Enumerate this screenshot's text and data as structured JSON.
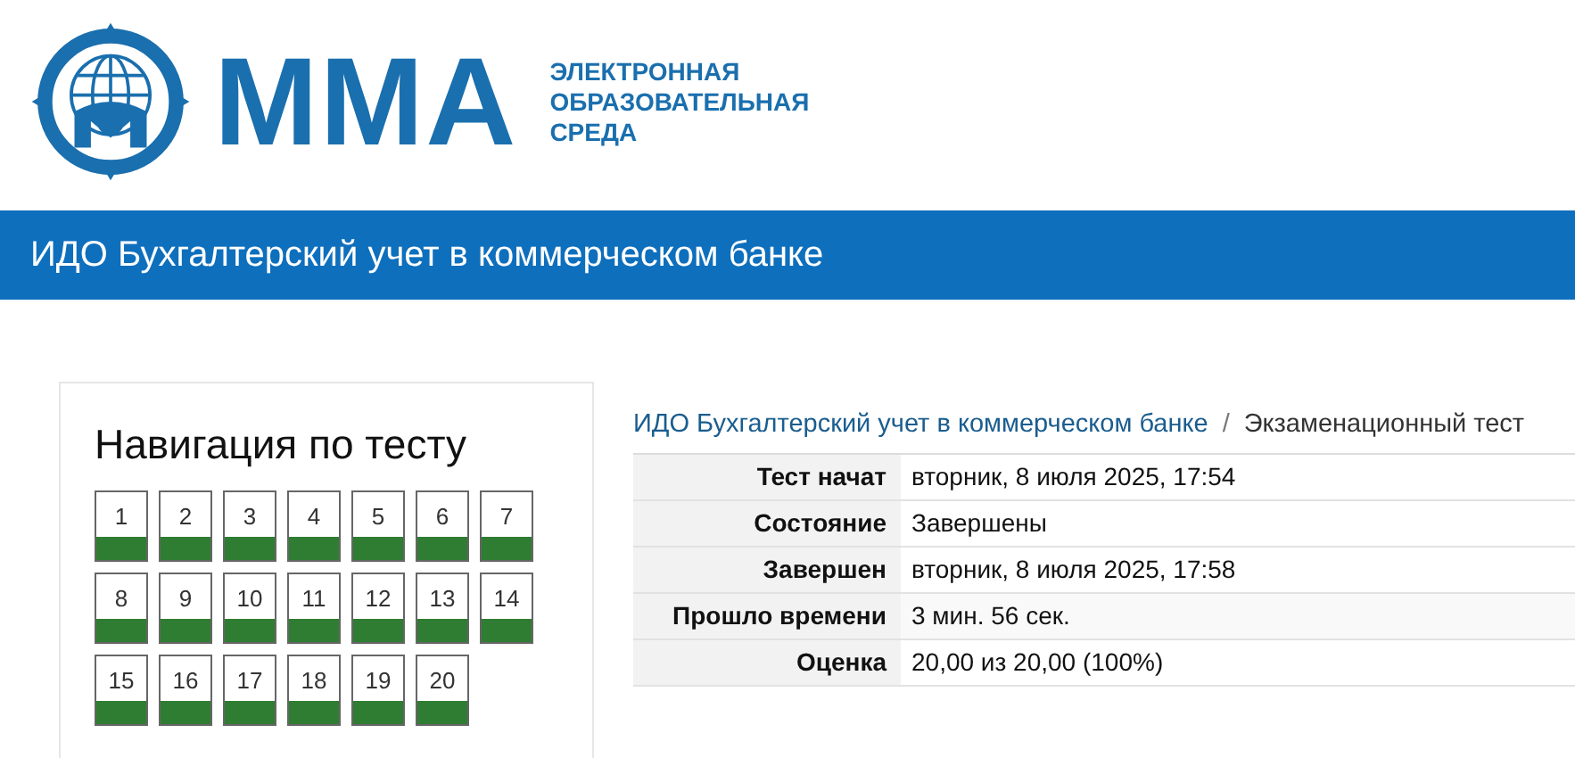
{
  "logo": {
    "brand": "ММА",
    "subtitle": [
      "ЭЛЕКТРОННАЯ",
      "ОБРАЗОВАТЕЛЬНАЯ",
      "СРЕДА"
    ]
  },
  "course_bar": {
    "title": "ИДО Бухгалтерский учет в коммерческом банке"
  },
  "quiz_navigation": {
    "title": "Навигация по тесту",
    "questions": [
      {
        "number": "1",
        "correct": true
      },
      {
        "number": "2",
        "correct": true
      },
      {
        "number": "3",
        "correct": true
      },
      {
        "number": "4",
        "correct": true
      },
      {
        "number": "5",
        "correct": true
      },
      {
        "number": "6",
        "correct": true
      },
      {
        "number": "7",
        "correct": true
      },
      {
        "number": "8",
        "correct": true
      },
      {
        "number": "9",
        "correct": true
      },
      {
        "number": "10",
        "correct": true
      },
      {
        "number": "11",
        "correct": true
      },
      {
        "number": "12",
        "correct": true
      },
      {
        "number": "13",
        "correct": true
      },
      {
        "number": "14",
        "correct": true
      },
      {
        "number": "15",
        "correct": true
      },
      {
        "number": "16",
        "correct": true
      },
      {
        "number": "17",
        "correct": true
      },
      {
        "number": "18",
        "correct": true
      },
      {
        "number": "19",
        "correct": true
      },
      {
        "number": "20",
        "correct": true
      }
    ]
  },
  "breadcrumb": [
    {
      "label": "ИДО Бухгалтерский учет в коммерческом банке",
      "link": true
    },
    {
      "label": "Экзаменационный тест",
      "link": false
    }
  ],
  "breadcrumb_separator": "/",
  "summary": [
    {
      "label": "Тест начат",
      "value": "вторник, 8 июля 2025, 17:54"
    },
    {
      "label": "Состояние",
      "value": "Завершены"
    },
    {
      "label": "Завершен",
      "value": "вторник, 8 июля 2025, 17:58"
    },
    {
      "label": "Прошло времени",
      "value": "3 мин. 56 сек."
    },
    {
      "label": "Оценка",
      "value": "20,00 из 20,00 (100%)"
    }
  ]
}
